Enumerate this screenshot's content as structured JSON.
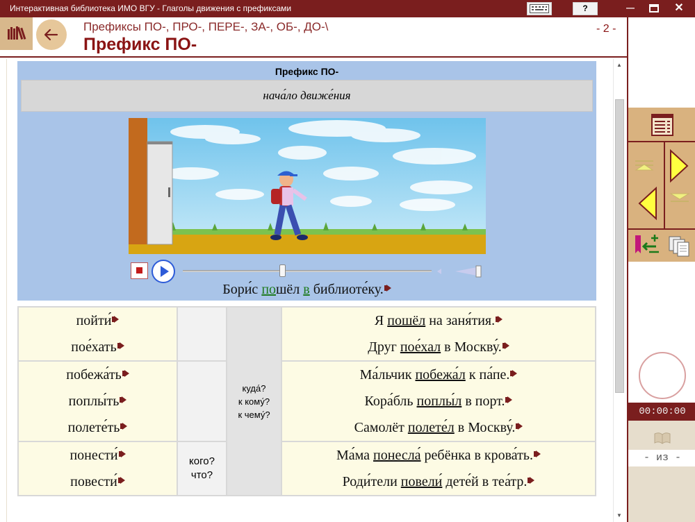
{
  "window": {
    "title": "Интерактивная библиотека ИМО ВГУ  -  Глаголы движения с префиксами",
    "help_label": "?",
    "min_label": "—",
    "close_label": "✕"
  },
  "header": {
    "subtitle": "Префиксы ПО-, ПРО-, ПЕРЕ-, ЗА-, ОБ-, ДО-\\",
    "title": "Префикс ПО-",
    "page_number": "- 2 -"
  },
  "animation": {
    "title": "Префикс ПО-",
    "meaning": "нача́ло движе́ния",
    "progress": 0.4,
    "sentence": {
      "part1": "Бори́с ",
      "prefix": "по",
      "part2": "шёл ",
      "prep": "в",
      "part3": " библиоте́ку."
    }
  },
  "table": {
    "rows": [
      {
        "verbs": [
          "пойти́",
          "пое́хать"
        ],
        "question1": "",
        "sentences": [
          {
            "before": "Я ",
            "verb": "пошёл",
            "after": " на заня́тия."
          },
          {
            "before": "Друг ",
            "verb": "пое́хал",
            "after": " в Москву́."
          }
        ]
      },
      {
        "verbs": [
          "побежа́ть",
          "поплы́ть",
          "полете́ть"
        ],
        "question1": "",
        "sentences": [
          {
            "before": "Ма́льчик ",
            "verb": "побежа́л",
            "after": " к па́пе."
          },
          {
            "before": "Кора́бль ",
            "verb": "поплы́л",
            "after": " в порт."
          },
          {
            "before": "Самолёт ",
            "verb": "полете́л",
            "after": " в Москву́."
          }
        ]
      },
      {
        "verbs": [
          "понести́",
          "повести́"
        ],
        "question1": "кого?\nчто?",
        "sentences": [
          {
            "before": "Ма́ма ",
            "verb": "понесла́",
            "after": " ребёнка в крова́ть."
          },
          {
            "before": "Роди́тели ",
            "verb": "повели́",
            "after": " дете́й в теа́тр."
          }
        ]
      }
    ],
    "direction_question": "куда́?\nк кому́?\nк чему́?"
  },
  "sidebar": {
    "timer": "00:00:00",
    "page_of": "- из -"
  },
  "colors": {
    "brand": "#7a1e1e",
    "nav_bg": "#d9b27f",
    "panel_bg": "#a9c4e8",
    "cell_bg": "#fdfbe4"
  },
  "icons": [
    "library-icon",
    "back-arrow-icon",
    "keyboard-icon",
    "contents-icon",
    "first-page-icon",
    "next-page-icon",
    "prev-page-icon",
    "last-page-icon",
    "bookmark-icon",
    "copy-icon",
    "stop-icon",
    "play-icon",
    "volume-icon",
    "sound-icon",
    "book-icon"
  ]
}
